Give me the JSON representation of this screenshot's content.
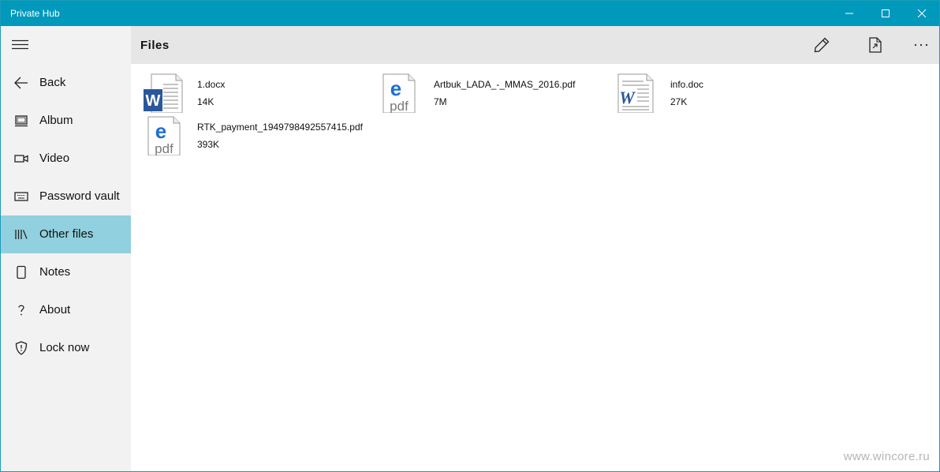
{
  "window": {
    "title": "Private Hub",
    "accent_color": "#0099bc",
    "selected_color": "#91d0de"
  },
  "sidebar": {
    "items": [
      {
        "label": "Back",
        "icon": "back-arrow-icon"
      },
      {
        "label": "Album",
        "icon": "album-icon"
      },
      {
        "label": "Video",
        "icon": "video-camera-icon"
      },
      {
        "label": "Password vault",
        "icon": "keyboard-icon"
      },
      {
        "label": "Other files",
        "icon": "library-icon",
        "selected": true
      },
      {
        "label": "Notes",
        "icon": "note-icon"
      },
      {
        "label": "About",
        "icon": "question-icon"
      },
      {
        "label": "Lock now",
        "icon": "shield-icon"
      }
    ]
  },
  "header": {
    "title": "Files",
    "actions": [
      "edit-pencil-icon",
      "export-file-icon",
      "more-icon"
    ]
  },
  "files": [
    {
      "name": "1.docx",
      "size": "14K",
      "type": "docx"
    },
    {
      "name": "Artbuk_LADA_-_MMAS_2016.pdf",
      "size": "7M",
      "type": "pdf"
    },
    {
      "name": "info.doc",
      "size": "27K",
      "type": "doc"
    },
    {
      "name": "RTK_payment_1949798492557415.pdf",
      "size": "393K",
      "type": "pdf"
    }
  ],
  "watermark": "www.wincore.ru"
}
